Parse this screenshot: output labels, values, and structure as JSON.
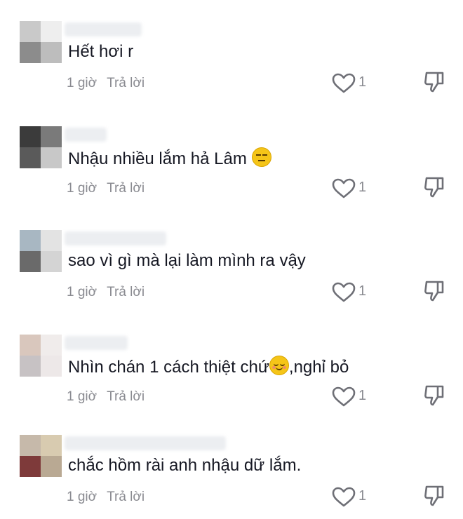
{
  "colors": {
    "text": "#161823",
    "meta": "#8a8b91",
    "icon": "#6e6f76"
  },
  "comments": [
    {
      "text": "Hết hơi r",
      "time": "1 giờ",
      "reply": "Trả lời",
      "likes": "1",
      "avatar": [
        "#c9c9c9",
        "#eeeeee",
        "#8c8c8c",
        "#bdbdbd"
      ]
    },
    {
      "text": "Nhậu nhiều lắm hả Lâm",
      "emoji": "expressionless-face-icon",
      "time": "1 giờ",
      "reply": "Trả lời",
      "likes": "1",
      "avatar": [
        "#3b3b3b",
        "#7a7a7a",
        "#5a5a5a",
        "#c8c8c8"
      ]
    },
    {
      "text": "sao vì gì mà lại làm mình ra vậy",
      "time": "1 giờ",
      "reply": "Trả lời",
      "likes": "1",
      "avatar": [
        "#a8b7c2",
        "#e3e3e3",
        "#6a6a6a",
        "#d4d4d4"
      ]
    },
    {
      "text": "Nhìn chán 1 cách thiệt chứ",
      "text_after": ",nghỉ bỏ",
      "emoji": "relieved-face-icon",
      "time": "1 giờ",
      "reply": "Trả lời",
      "likes": "1",
      "avatar": [
        "#d9c7bd",
        "#f0eceb",
        "#c7c2c4",
        "#ede8e8"
      ]
    },
    {
      "text": "chắc hồm rài anh nhậu dữ lắm.",
      "time": "1 giờ",
      "reply": "Trả lời",
      "likes": "1",
      "avatar": [
        "#c6b9aa",
        "#d8cbb0",
        "#7e3a3a",
        "#b9a993"
      ]
    }
  ]
}
